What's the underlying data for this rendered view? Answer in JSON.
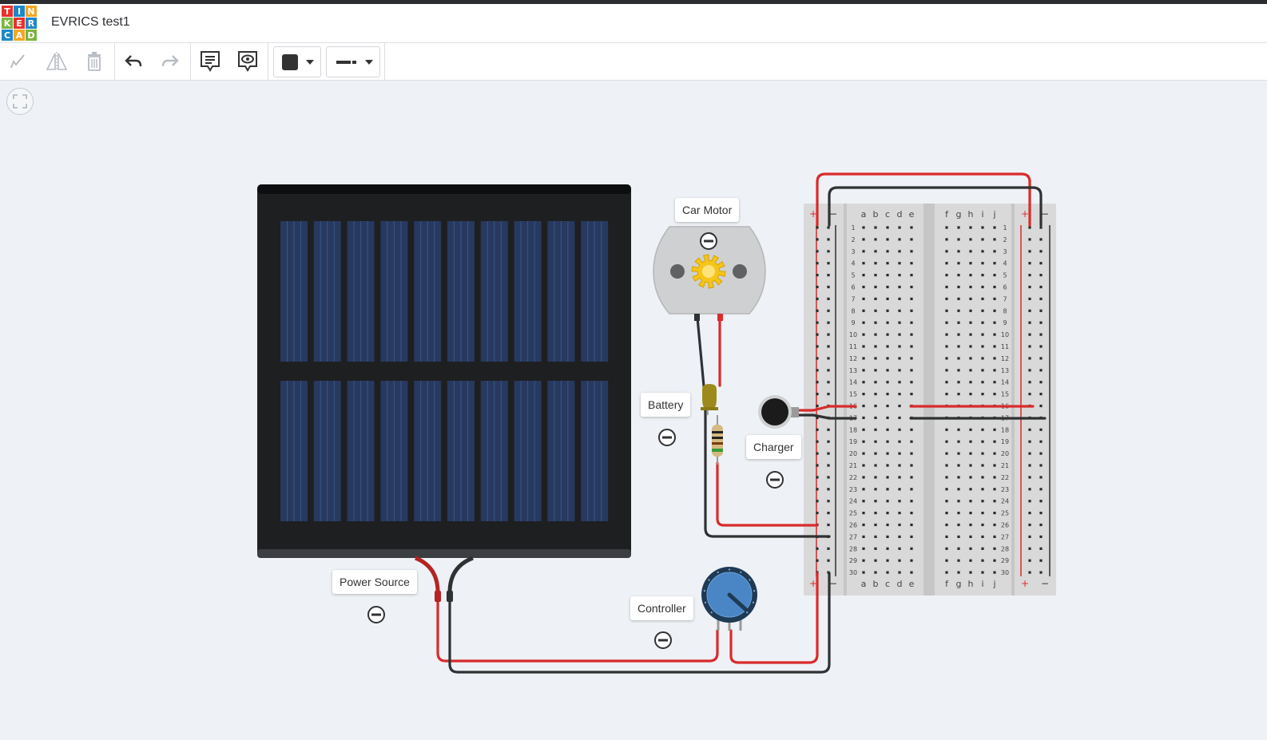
{
  "app": {
    "logo_letters": [
      "T",
      "I",
      "N",
      "K",
      "E",
      "R",
      "C",
      "A",
      "D"
    ],
    "logo_colors": [
      "#e8312f",
      "#1e88c7",
      "#f5a623",
      "#7cb342",
      "#e8312f",
      "#1e88c7",
      "#1e88c7",
      "#f5a623",
      "#7cb342"
    ],
    "project_title": "EVRICS test1"
  },
  "toolbar": {
    "tools": [
      "notes-pen-icon",
      "flip-icon",
      "delete-icon",
      "undo-icon",
      "redo-icon",
      "notes-icon",
      "notes-visibility-icon",
      "color-picker",
      "wire-style-picker"
    ],
    "fill_color": "#333333"
  },
  "breadboard": {
    "rows": [
      "1",
      "2",
      "3",
      "4",
      "5",
      "6",
      "7",
      "8",
      "9",
      "10",
      "11",
      "12",
      "13",
      "14",
      "15",
      "16",
      "17",
      "18",
      "19",
      "20",
      "21",
      "22",
      "23",
      "24",
      "25",
      "26",
      "27",
      "28",
      "29",
      "30"
    ],
    "left_cols": [
      "a",
      "b",
      "c",
      "d",
      "e"
    ],
    "right_cols": [
      "f",
      "g",
      "h",
      "i",
      "j"
    ],
    "plus": "+",
    "minus": "−"
  },
  "components": {
    "car_motor": "Car Motor",
    "battery": "Battery",
    "charger": "Charger",
    "power_source": "Power Source",
    "controller": "Controller"
  },
  "colors": {
    "wire_red": "#d92b2b",
    "wire_black": "#2f3133",
    "panel": "#1e1f21",
    "cell": "#27395f",
    "breadboard": "#d9d9d9"
  }
}
